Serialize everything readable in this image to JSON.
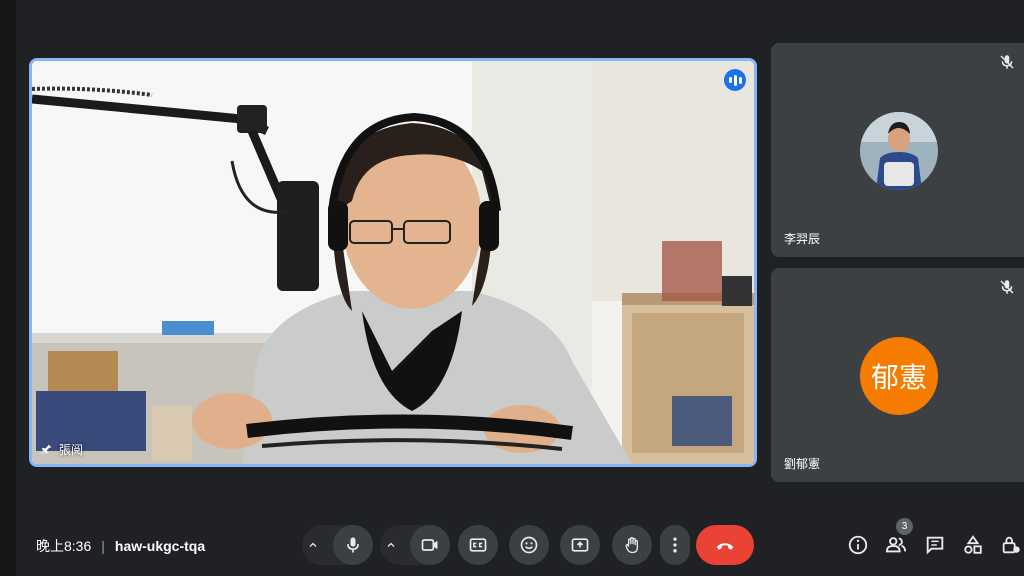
{
  "main_speaker": {
    "name": "張阅"
  },
  "participants": [
    {
      "name": "李羿辰",
      "muted": true,
      "avatar": "photo"
    },
    {
      "name": "劉郁憲",
      "muted": true,
      "avatar_text": "郁憲",
      "avatar_color": "#f57c00"
    }
  ],
  "meeting": {
    "time": "晚上8:36",
    "code": "haw-ukgc-tqa"
  },
  "controls": [
    "chevron-up-icon",
    "microphone-icon",
    "chevron-up-icon",
    "camera-icon",
    "captions-icon",
    "emoji-icon",
    "present-screen-icon",
    "raise-hand-icon",
    "more-options-icon",
    "end-call-icon"
  ],
  "right_controls": {
    "people_count": "3"
  },
  "colors": {
    "accent": "#8ab4f8",
    "end_call": "#ea4335",
    "tile_bg": "#3c4043",
    "background": "#202124"
  }
}
